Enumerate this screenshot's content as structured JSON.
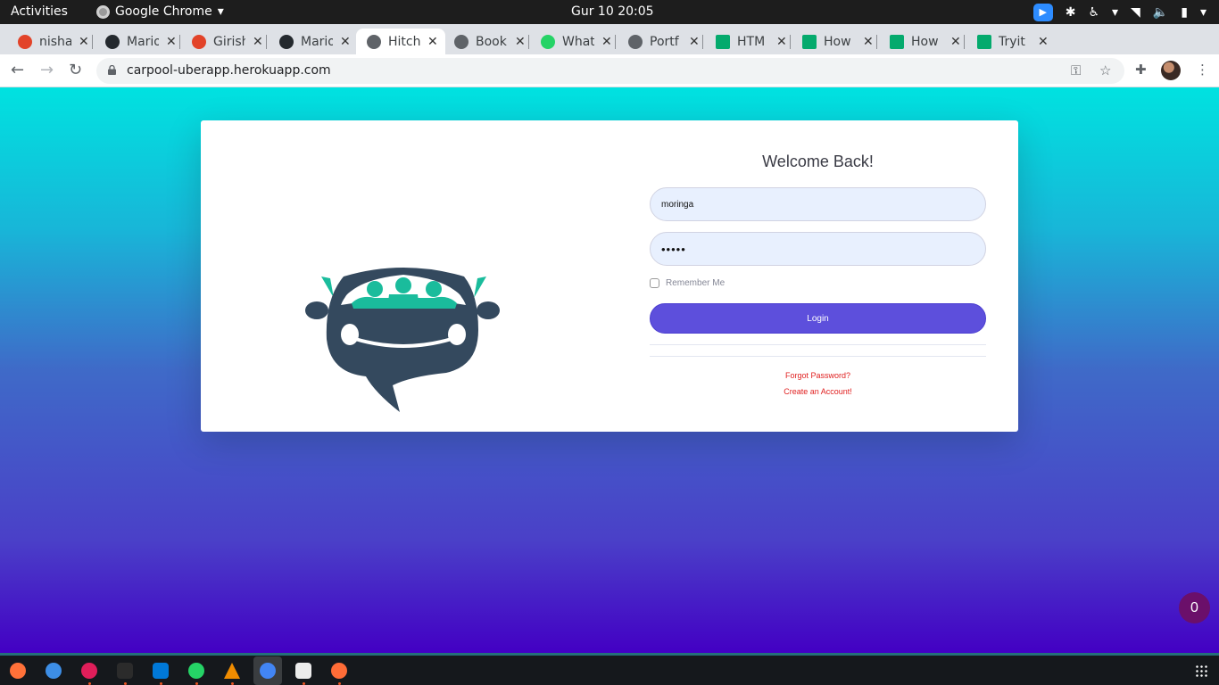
{
  "system_bar": {
    "activities": "Activities",
    "app_name": "Google Chrome",
    "clock": "Gur 10  20:05"
  },
  "tabs": [
    {
      "title": "nisha",
      "icon": "gitlab-icon",
      "active": false
    },
    {
      "title": "Mario",
      "icon": "github-icon",
      "active": false
    },
    {
      "title": "Girish",
      "icon": "gitlab-icon",
      "active": false
    },
    {
      "title": "Mario",
      "icon": "github-icon",
      "active": false
    },
    {
      "title": "Hitch",
      "icon": "globe-icon",
      "active": true
    },
    {
      "title": "Book",
      "icon": "globe-icon",
      "active": false
    },
    {
      "title": "What",
      "icon": "whatsapp-icon",
      "active": false
    },
    {
      "title": "Portf",
      "icon": "globe-icon",
      "active": false
    },
    {
      "title": "HTM",
      "icon": "w3schools-icon",
      "active": false
    },
    {
      "title": "How",
      "icon": "w3schools-icon",
      "active": false
    },
    {
      "title": "How",
      "icon": "w3schools-icon",
      "active": false
    },
    {
      "title": "Tryit",
      "icon": "w3schools-icon",
      "active": false
    }
  ],
  "address_bar": {
    "url": "carpool-uberapp.herokuapp.com"
  },
  "login": {
    "heading": "Welcome Back!",
    "username_value": "moringa",
    "password_value": "•••••",
    "remember_label": "Remember Me",
    "login_label": "Login",
    "forgot_password": "Forgot Password?",
    "create_account": "Create an Account!"
  },
  "badge": {
    "count": "0"
  },
  "colors": {
    "brand_teal": "#1abc9c",
    "car_dark": "#34495e",
    "login_button": "#5d4fdc",
    "link_red": "#e02020"
  },
  "dock": {
    "apps": [
      "firefox-icon",
      "help-icon",
      "slack-icon",
      "terminal-icon",
      "vscode-icon",
      "whatsapp-icon",
      "vlc-icon",
      "chrome-icon",
      "files-icon",
      "postman-icon"
    ]
  }
}
